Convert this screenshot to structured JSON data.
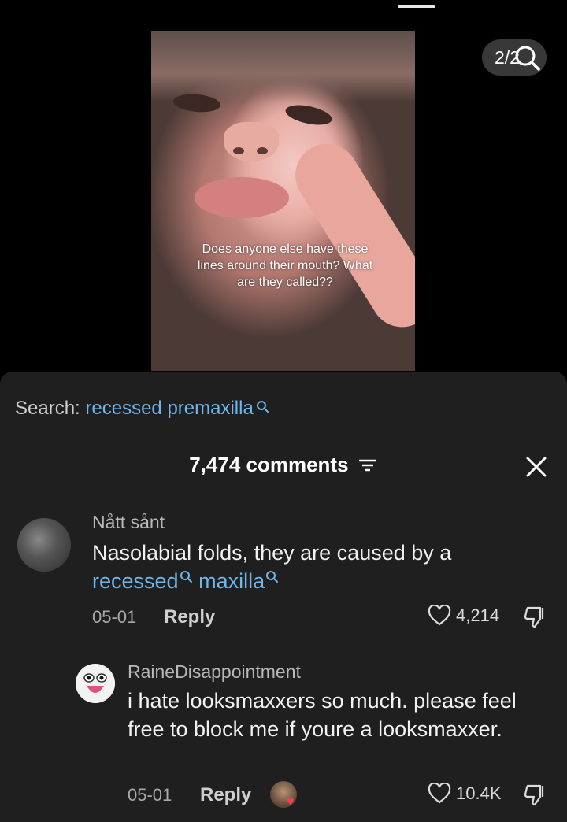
{
  "video": {
    "caption": "Does anyone else have these lines around their mouth? What are they called??",
    "counter": "2/2"
  },
  "search": {
    "label": "Search:",
    "term": "recessed premaxilla"
  },
  "comments": {
    "count_label": "7,474 comments"
  },
  "comment1": {
    "username": "Nått sånt",
    "text_plain": "Nasolabial folds, they are caused by a",
    "text_link1": "recessed",
    "text_link2": "maxilla",
    "date": "05-01",
    "reply_label": "Reply",
    "likes": "4,214"
  },
  "comment2": {
    "username": "RaineDisappointment",
    "text": "i hate looksmaxxers so much. please feel free to block me if youre a looksmaxxer.",
    "date": "05-01",
    "reply_label": "Reply",
    "likes": "10.4K"
  },
  "colors": {
    "background": "#000000",
    "sheet": "#1f1f1f",
    "link": "#6fb6ea",
    "like_heart": "#ff3b5c"
  }
}
